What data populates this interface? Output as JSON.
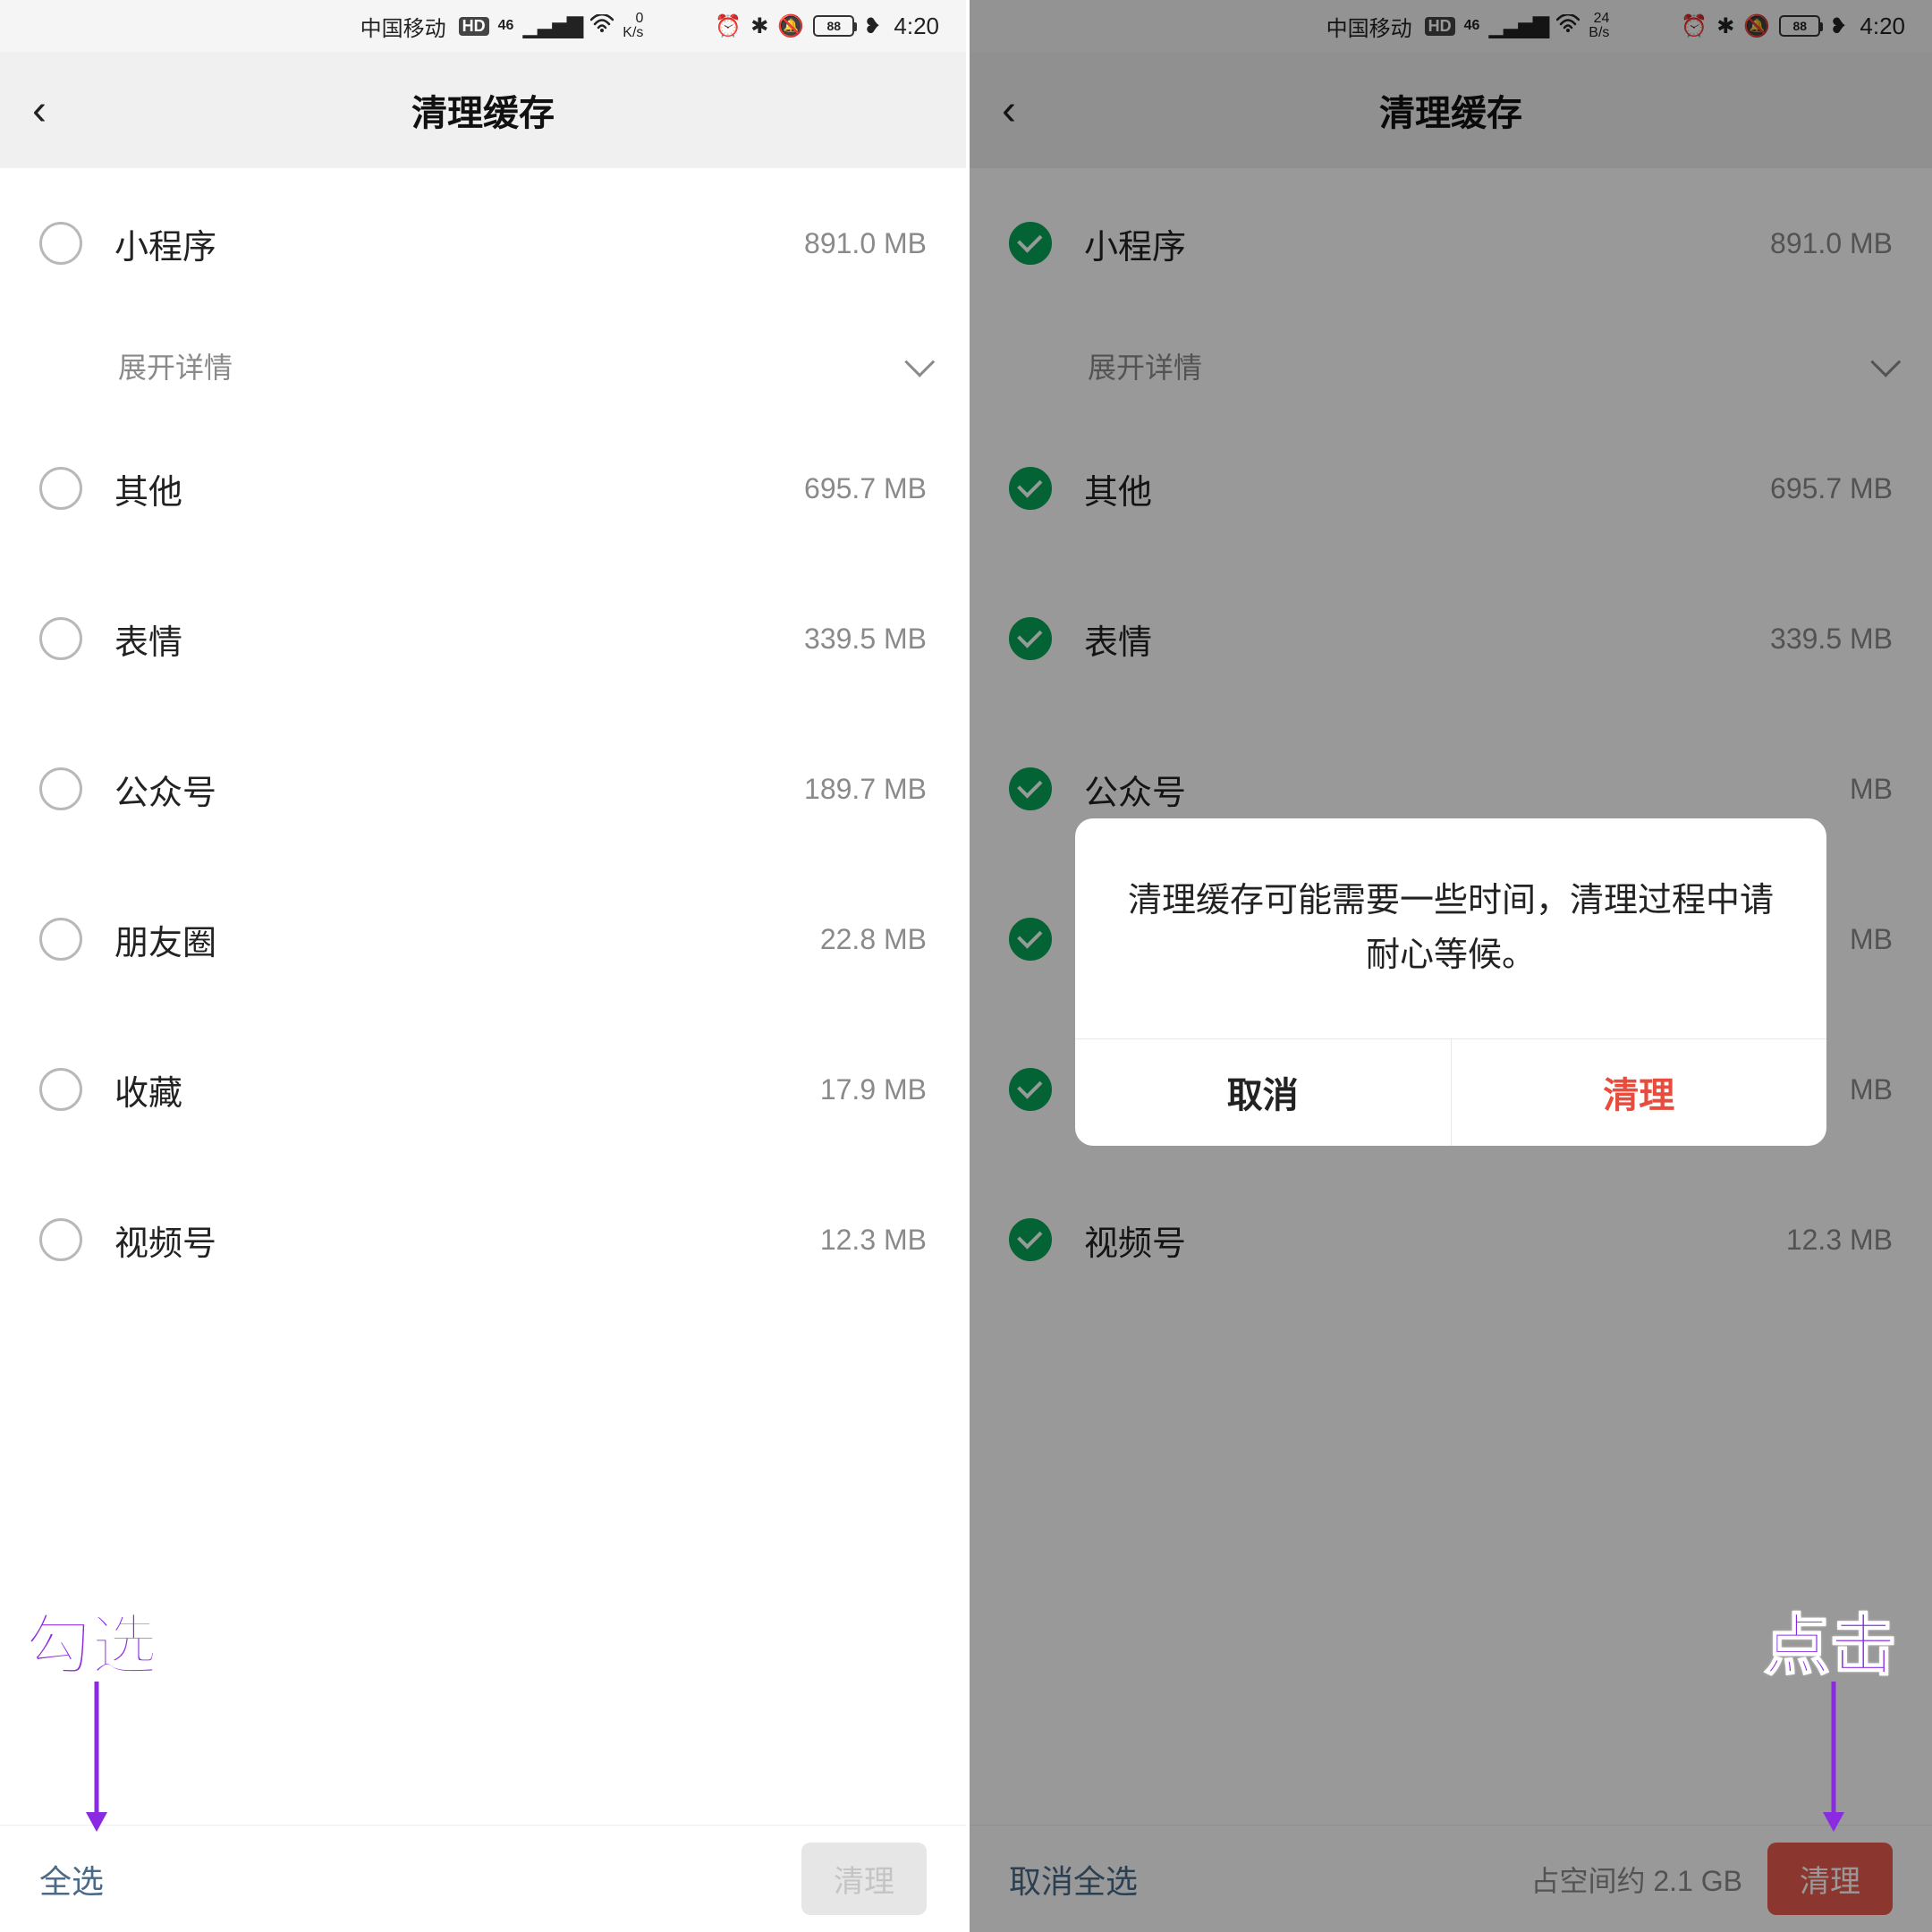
{
  "status": {
    "carrier": "中国移动",
    "hd": "HD",
    "net": "46",
    "speed_left_top": "0",
    "speed_left_bot": "K/s",
    "speed_right_top": "24",
    "speed_right_bot": "B/s",
    "battery": "88",
    "time": "4:20"
  },
  "header": {
    "title": "清理缓存"
  },
  "items": [
    {
      "label": "小程序",
      "size": "891.0 MB"
    },
    {
      "label": "其他",
      "size": "695.7 MB"
    },
    {
      "label": "表情",
      "size": "339.5 MB"
    },
    {
      "label": "公众号",
      "size": "189.7 MB"
    },
    {
      "label": "朋友圈",
      "size": "22.8 MB"
    },
    {
      "label": "收藏",
      "size": "17.9 MB"
    },
    {
      "label": "视频号",
      "size": "12.3 MB"
    }
  ],
  "expand": "展开详情",
  "right_items_partial": [
    {
      "size": "MB"
    },
    {
      "size": "MB"
    },
    {
      "size": "MB"
    }
  ],
  "bottom": {
    "select_all": "全选",
    "unselect_all": "取消全选",
    "space_about": "占空间约 2.1 GB",
    "clean": "清理"
  },
  "dialog": {
    "message": "清理缓存可能需要一些时间，清理过程中请耐心等候。",
    "cancel": "取消",
    "confirm": "清理"
  },
  "annotations": {
    "left": "勾选",
    "right": "点击"
  },
  "colors": {
    "accent_green": "#07a658",
    "accent_purple": "#8a2be2",
    "danger_red": "#e74c3c"
  }
}
